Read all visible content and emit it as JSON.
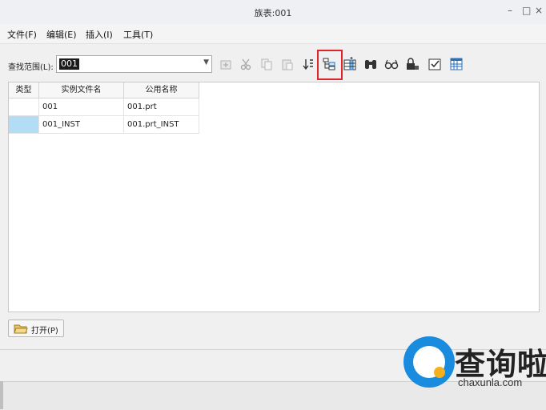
{
  "window": {
    "title": "族表:001",
    "controls": {
      "minimize": "–",
      "maximize": "□",
      "close": "×"
    }
  },
  "menu": {
    "items": [
      {
        "label": "文件(F)"
      },
      {
        "label": "编辑(E)"
      },
      {
        "label": "插入(I)"
      },
      {
        "label": "工具(T)"
      }
    ]
  },
  "toolbar": {
    "lookin_label": "查找范围(L):",
    "lookin_value": "001",
    "icons": [
      "insert-row-icon",
      "cut-icon",
      "copy-icon",
      "paste-icon",
      "sort-icon",
      "add-item-icon",
      "add-column-icon",
      "find-icon",
      "preview-icon",
      "lock-icon",
      "verify-icon",
      "table-editor-icon"
    ],
    "highlight_color": "#e0242a"
  },
  "table": {
    "columns": [
      "类型",
      "实例文件名",
      "公用名称"
    ],
    "rows": [
      {
        "type": "",
        "instance": "001",
        "common": "001.prt",
        "selected": false
      },
      {
        "type": "",
        "instance": "001_INST",
        "common": "001.prt_INST",
        "selected": true
      }
    ],
    "selected_color": "#b3dcf5"
  },
  "footer": {
    "open_label": "打开(P)"
  },
  "watermark": {
    "name": "查询啦",
    "domain": "chaxunla.com"
  }
}
